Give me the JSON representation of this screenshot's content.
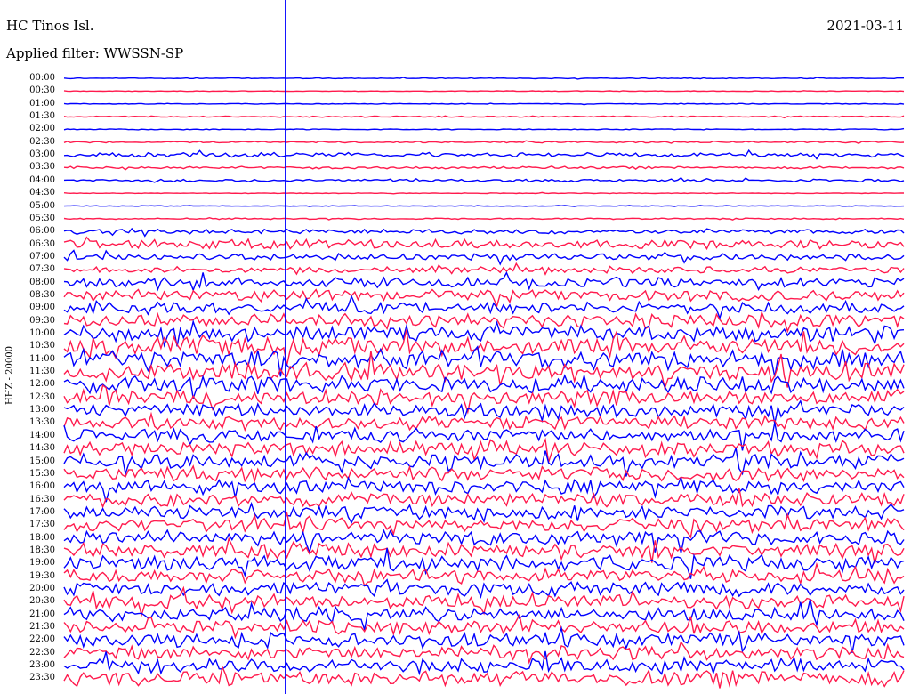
{
  "header": {
    "station": "HC Tinos Isl.",
    "date": "2021-03-11",
    "filter": "Applied filter: WWSSN-SP"
  },
  "chart_data": {
    "type": "line",
    "channel_label": "HHZ - 20000",
    "x_unit": "minutes within hour",
    "x_range": [
      0,
      30
    ],
    "row_labels": [
      "00:00",
      "00:30",
      "01:00",
      "01:30",
      "02:00",
      "02:30",
      "03:00",
      "03:30",
      "04:00",
      "04:30",
      "05:00",
      "05:30",
      "06:00",
      "06:30",
      "07:00",
      "07:30",
      "08:00",
      "08:30",
      "09:00",
      "09:30",
      "10:00",
      "10:30",
      "11:00",
      "11:30",
      "12:00",
      "12:30",
      "13:00",
      "13:30",
      "14:00",
      "14:30",
      "15:00",
      "15:30",
      "16:00",
      "16:30",
      "17:00",
      "17:30",
      "18:00",
      "18:30",
      "19:00",
      "19:30",
      "20:00",
      "20:30",
      "21:00",
      "21:30",
      "22:00",
      "22:30",
      "23:00",
      "23:30"
    ],
    "row_colors": [
      "#0000ff",
      "#ff1a4d"
    ],
    "relative_amplitude": [
      0.07,
      0.05,
      0.06,
      0.1,
      0.07,
      0.12,
      0.35,
      0.18,
      0.2,
      0.05,
      0.05,
      0.1,
      0.35,
      0.7,
      0.55,
      0.5,
      0.75,
      0.85,
      0.9,
      1.1,
      1.2,
      1.4,
      1.5,
      1.4,
      1.3,
      1.2,
      1.1,
      1.05,
      1.05,
      1.1,
      1.15,
      1.1,
      1.1,
      1.05,
      1.05,
      1.1,
      1.15,
      1.1,
      1.2,
      1.15,
      1.1,
      1.1,
      1.05,
      1.05,
      1.1,
      1.1,
      1.15,
      1.2
    ],
    "marker_line": {
      "color": "#0000ff",
      "minute": 7.9
    }
  }
}
